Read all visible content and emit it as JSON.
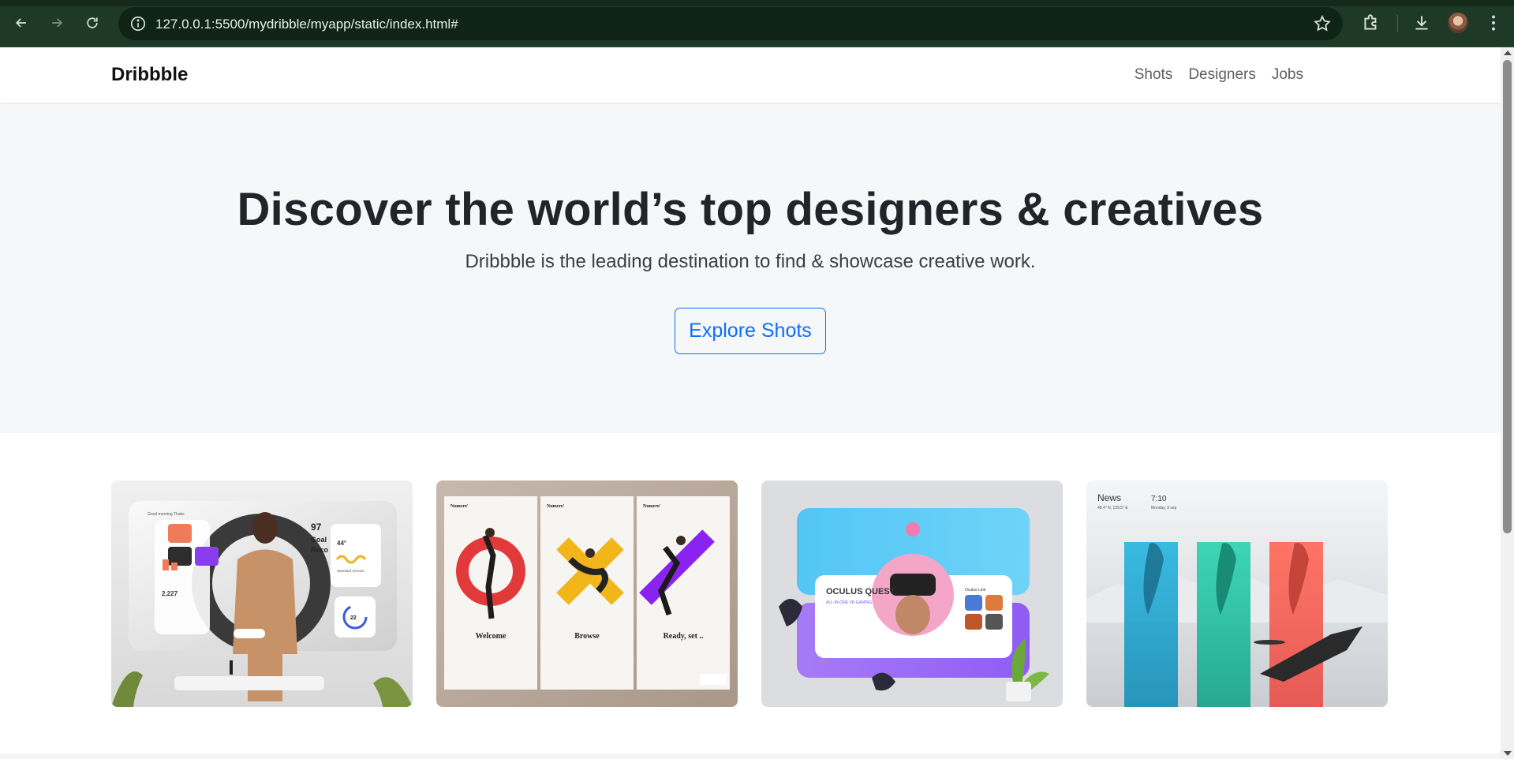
{
  "browser": {
    "url": "127.0.0.1:5500/mydribble/myapp/static/index.html#",
    "icons": [
      "back-arrow-icon",
      "forward-arrow-icon",
      "reload-icon",
      "site-info-icon",
      "bookmark-star-icon",
      "extensions-icon",
      "download-icon",
      "profile-avatar",
      "menu-dots-icon"
    ]
  },
  "navbar": {
    "brand": "Dribbble",
    "links": [
      {
        "label": "Shots"
      },
      {
        "label": "Designers"
      },
      {
        "label": "Jobs"
      }
    ]
  },
  "hero": {
    "title": "Discover the world’s top designers & creatives",
    "subtitle": "Dribbble is the leading destination to find & showcase creative work.",
    "button_label": "Explore Shots"
  },
  "shots": {
    "items": [
      {
        "name": "smart-home-dashboard-shot",
        "texts": [
          "Good morning Thaks",
          "97",
          "Goal",
          "Reco",
          "44°",
          "2,227",
          "22",
          "Standard Snooze"
        ]
      },
      {
        "name": "numero-onboarding-shot",
        "texts": [
          "Numero'",
          "Welcome",
          "Browse",
          "Ready, set .."
        ]
      },
      {
        "name": "oculus-quest-shot",
        "texts": [
          "OCULUS QUEST",
          "ALL-IN-ONE VR GAMING",
          "Oculus Link"
        ]
      },
      {
        "name": "news-weather-shot",
        "texts": [
          "News",
          "7:10",
          "Monday, 9 sep",
          "48.4° N, 129.5° E"
        ]
      }
    ]
  },
  "colors": {
    "chrome_bg": "#1e3a26",
    "hero_bg": "#f6f7f9",
    "accent": "#0d6efd"
  }
}
